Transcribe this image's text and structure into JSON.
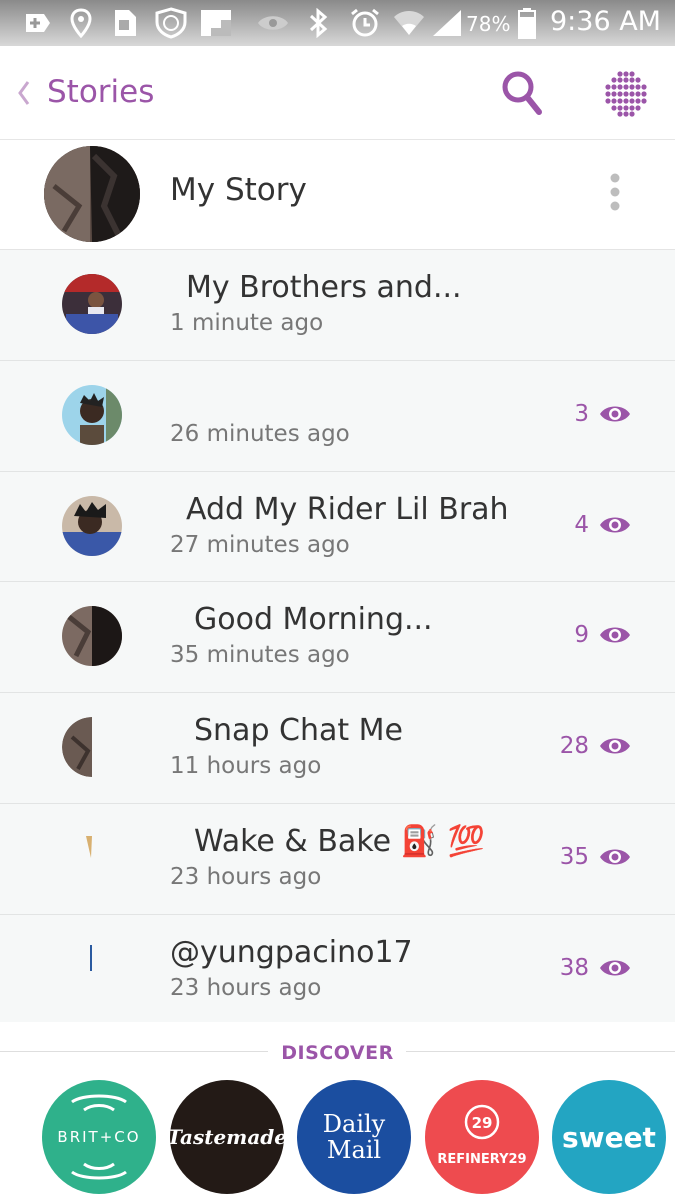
{
  "status_bar": {
    "battery_percent": "78%",
    "time": "9:36 AM",
    "icons": [
      "add-icon",
      "location-icon",
      "sim-icon",
      "shield-icon",
      "flipboard-icon",
      "eye-icon",
      "bluetooth-icon",
      "alarm-icon",
      "wifi-icon",
      "signal-icon",
      "battery-icon"
    ]
  },
  "header": {
    "back_label": "Stories",
    "accent_color": "#9b55a8"
  },
  "my_story": {
    "label": "My Story"
  },
  "stories": [
    {
      "title": "My Brothers and...",
      "time": "1 minute ago",
      "views": ""
    },
    {
      "title": "",
      "time": "26 minutes ago",
      "views": "3"
    },
    {
      "title": "Add My Rider Lil Brah",
      "time": "27 minutes ago",
      "views": "4"
    },
    {
      "title": "Good Morning...",
      "time": "35 minutes ago",
      "views": "9"
    },
    {
      "title": "Snap Chat Me",
      "time": "11 hours ago",
      "views": "28"
    },
    {
      "title": "Wake & Bake ⛽ 💯",
      "time": "23 hours ago",
      "views": "35"
    },
    {
      "title": "@yungpacino17",
      "time": "23 hours ago",
      "views": "38"
    }
  ],
  "discover": {
    "label": "DISCOVER",
    "channels": [
      {
        "name": "BRIT+CO",
        "color": "#2fb18b"
      },
      {
        "name": "Tastemade",
        "color": "#231a16"
      },
      {
        "name": "Daily Mail",
        "color": "#1b4ea0"
      },
      {
        "name": "REFINERY29",
        "color": "#ee4b4f"
      },
      {
        "name": "sweet",
        "color": "#23a5c2"
      }
    ]
  }
}
